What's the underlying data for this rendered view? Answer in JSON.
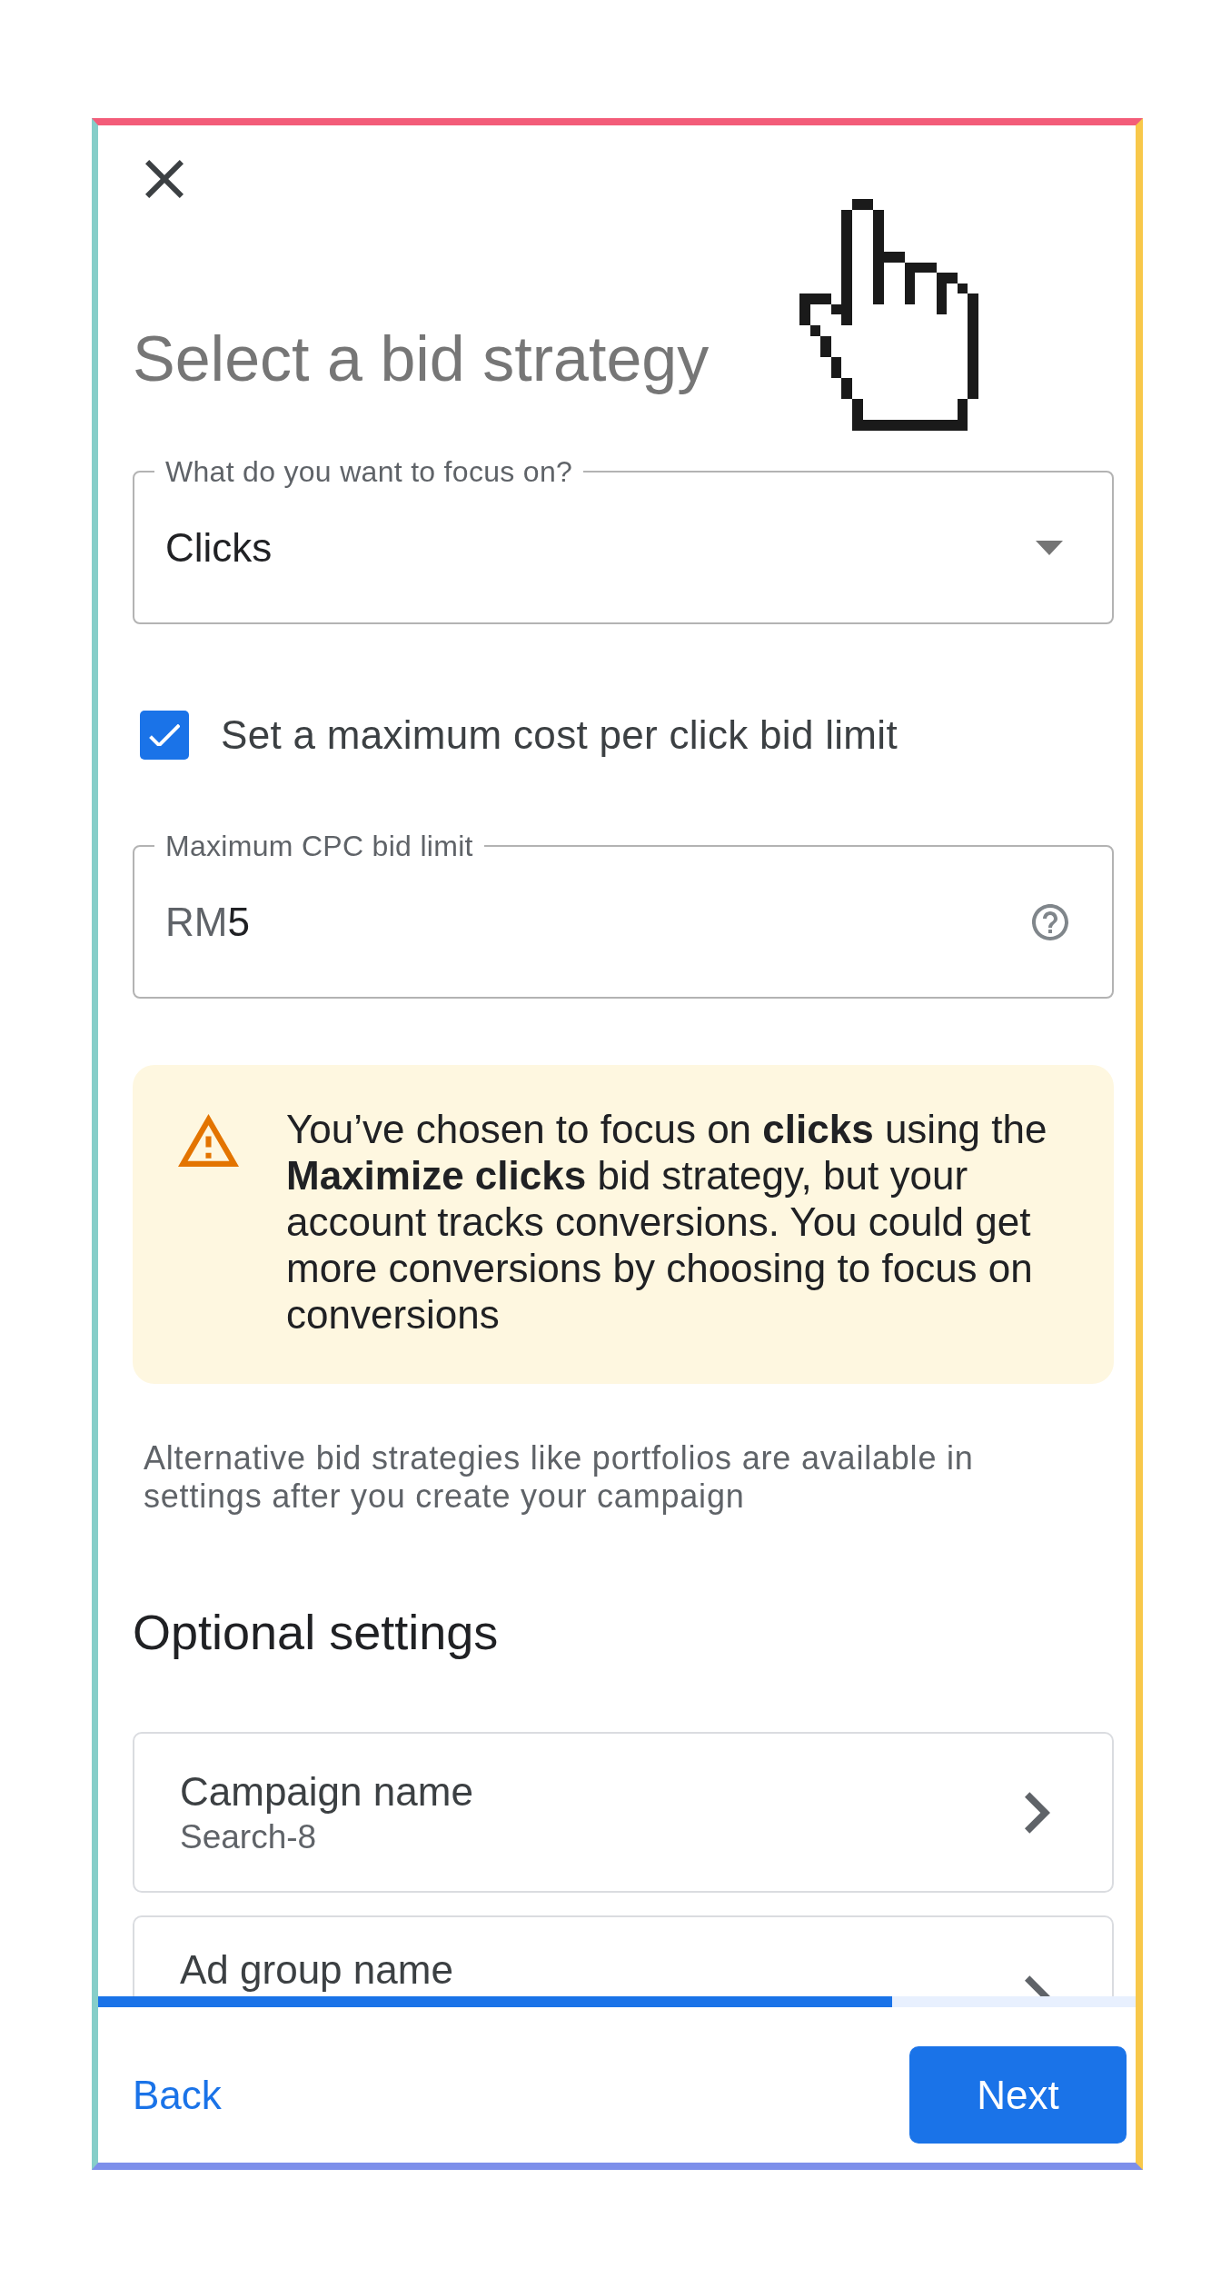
{
  "title": "Select a bid strategy",
  "focus_dropdown": {
    "label": "What do you want to focus on?",
    "value": "Clicks"
  },
  "bid_limit_checkbox": {
    "label": "Set a maximum cost per click bid limit",
    "checked": true
  },
  "bid_limit_field": {
    "label": "Maximum CPC bid limit",
    "prefix": "RM",
    "value": "5"
  },
  "warning": {
    "text": "You’ve chosen to focus on **clicks** using the **Maximize clicks** bid strategy, but your account tracks conversions. You could get more conversions by choosing to focus on conversions"
  },
  "note": "Alternative bid strategies like portfolios are available in settings after you create your campaign",
  "optional_settings": {
    "heading": "Optional settings",
    "items": [
      {
        "name": "Campaign name",
        "value": "Search-8"
      },
      {
        "name": "Ad group name"
      }
    ]
  },
  "progress": {
    "level": 0.765
  },
  "footer": {
    "back": "Back",
    "next": "Next"
  }
}
